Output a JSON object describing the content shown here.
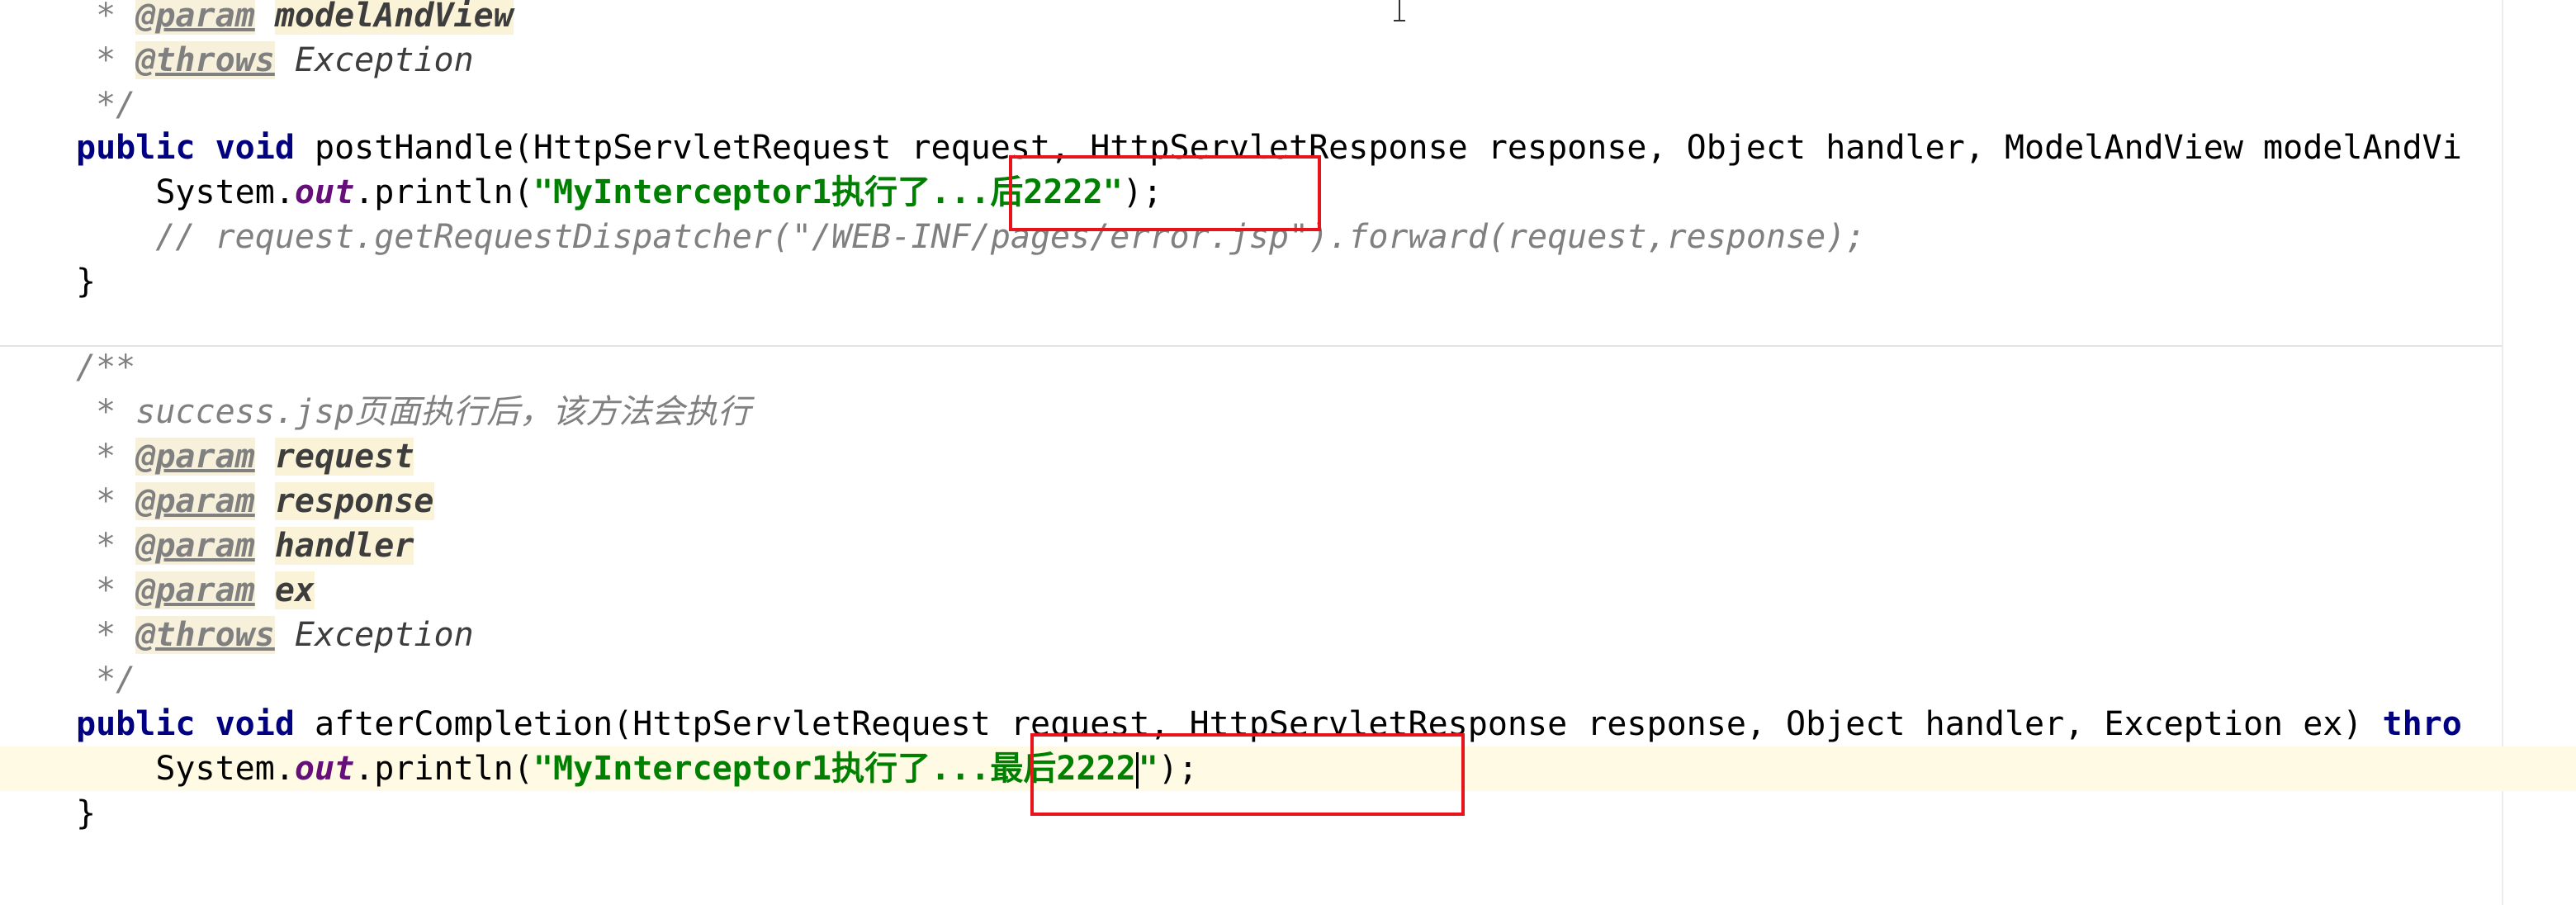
{
  "editor": {
    "lines": {
      "l1": {
        "prefix": " * ",
        "tag": "@param",
        "name": "modelAndView"
      },
      "l2": {
        "prefix": " * ",
        "tag": "@throws",
        "rest": " Exception"
      },
      "l3": {
        "text": " */"
      },
      "l4": {
        "kw": "public void",
        "sig": " postHandle(HttpServletRequest request, HttpServletResponse response, Object handler, ModelAndView modelAndVi"
      },
      "l5": {
        "pre": "    System.",
        "field": "out",
        "mid": ".println(",
        "str": "\"MyInterceptor1执行了...后2222\"",
        "post": ");"
      },
      "l6": {
        "comment": "    // request.getRequestDispatcher(\"/WEB-INF/pages/error.jsp\").forward(request,response);"
      },
      "l7": {
        "text": "}"
      },
      "l8": {
        "text": "/**"
      },
      "l9": {
        "prefix": " * ",
        "text": "success.jsp页面执行后，该方法会执行"
      },
      "l10": {
        "prefix": " * ",
        "tag": "@param",
        "name": "request"
      },
      "l11": {
        "prefix": " * ",
        "tag": "@param",
        "name": "response"
      },
      "l12": {
        "prefix": " * ",
        "tag": "@param",
        "name": "handler"
      },
      "l13": {
        "prefix": " * ",
        "tag": "@param",
        "name": "ex"
      },
      "l14": {
        "prefix": " * ",
        "tag": "@throws",
        "rest": " Exception"
      },
      "l15": {
        "text": " */"
      },
      "l16": {
        "kw": "public void",
        "sig": " afterCompletion(HttpServletRequest request, HttpServletResponse response, Object handler, Exception ex) ",
        "kw2": "thro"
      },
      "l17": {
        "pre": "    System.",
        "field": "out",
        "mid": ".println(",
        "str_a": "\"MyInterceptor1执行了...最后2222",
        "str_b": "\"",
        "post": ");"
      },
      "l18": {
        "text": "}"
      }
    }
  },
  "colors": {
    "keyword": "#000080",
    "string": "#008000",
    "comment": "#808080",
    "annotation_box": "#e8141b",
    "current_line": "#fffae3"
  }
}
